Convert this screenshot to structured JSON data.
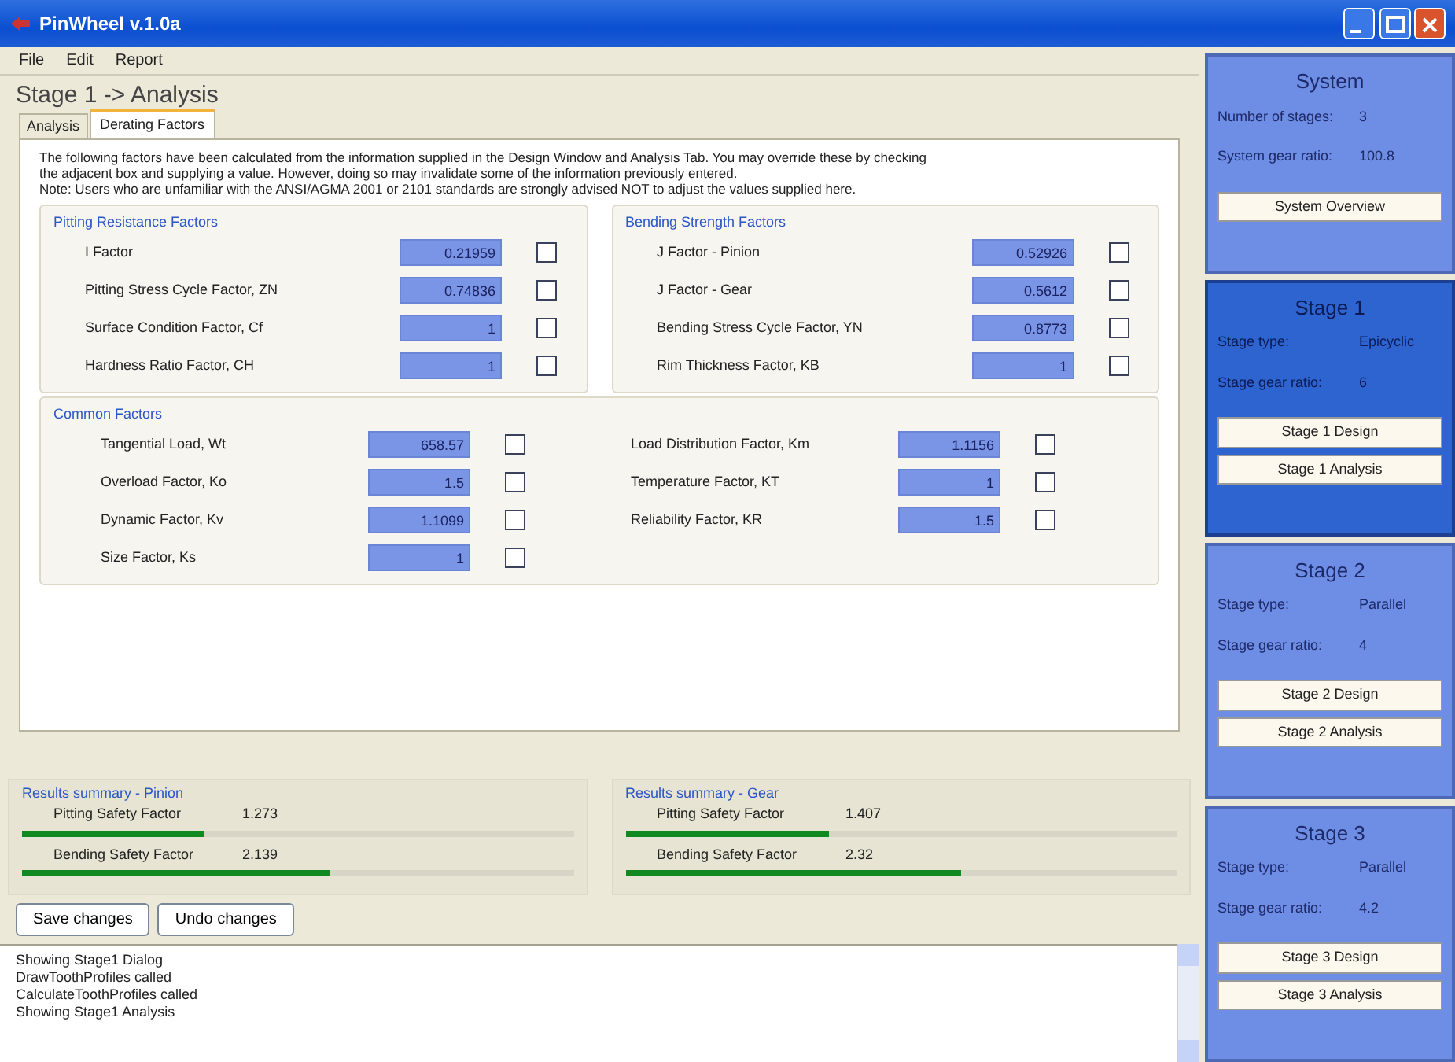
{
  "window": {
    "title": "PinWheel v.1.0a"
  },
  "menu": [
    "File",
    "Edit",
    "Report"
  ],
  "heading": "Stage 1 -> Analysis",
  "tabs": [
    {
      "label": "Analysis",
      "selected": false
    },
    {
      "label": "Derating Factors",
      "selected": true
    }
  ],
  "intro": [
    "The following factors have been calculated from the information supplied in the Design Window and Analysis Tab. You may override these by checking",
    "the adjacent box and supplying a value. However, doing so may invalidate some of the information previously entered.",
    "Note: Users who are unfamiliar with the ANSI/AGMA 2001 or 2101 standards are strongly advised NOT to adjust the values supplied here."
  ],
  "groups": [
    {
      "title": "Pitting Resistance Factors",
      "factors": [
        {
          "label": "I Factor",
          "value": "0.21959",
          "checked": false
        },
        {
          "label": "Pitting Stress Cycle Factor, ZN",
          "value": "0.74836",
          "checked": false
        },
        {
          "label": "Surface Condition Factor, Cf",
          "value": "1",
          "checked": false
        },
        {
          "label": "Hardness Ratio Factor, CH",
          "value": "1",
          "checked": false
        }
      ]
    },
    {
      "title": "Bending Strength Factors",
      "factors": [
        {
          "label": "J Factor - Pinion",
          "value": "0.52926",
          "checked": false
        },
        {
          "label": "J Factor - Gear",
          "value": "0.5612",
          "checked": false
        },
        {
          "label": "Bending Stress Cycle Factor, YN",
          "value": "0.8773",
          "checked": false
        },
        {
          "label": "Rim Thickness Factor, KB",
          "value": "1",
          "checked": false
        }
      ]
    }
  ],
  "common": {
    "title": "Common Factors",
    "columns": [
      [
        {
          "label": "Tangential Load, Wt",
          "value": "658.57",
          "checked": false
        },
        {
          "label": "Overload Factor, Ko",
          "value": "1.5",
          "checked": false
        },
        {
          "label": "Dynamic Factor, Kv",
          "value": "1.1099",
          "checked": false
        },
        {
          "label": "Size Factor, Ks",
          "value": "1",
          "checked": false
        }
      ],
      [
        {
          "label": "Load Distribution Factor, Km",
          "value": "1.1156",
          "checked": false
        },
        {
          "label": "Temperature Factor, KT",
          "value": "1",
          "checked": false
        },
        {
          "label": "Reliability Factor, KR",
          "value": "1.5",
          "checked": false
        }
      ]
    ]
  },
  "results": [
    {
      "title": "Results summary - Pinion",
      "items": [
        {
          "label": "Pitting Safety Factor",
          "reading": "1.273",
          "level": 0.33
        },
        {
          "label": "Bending Safety Factor",
          "reading": "2.139",
          "level": 0.56
        }
      ]
    },
    {
      "title": "Results summary - Gear",
      "items": [
        {
          "label": "Pitting Safety Factor",
          "reading": "1.407",
          "level": 0.37
        },
        {
          "label": "Bending Safety Factor",
          "reading": "2.32",
          "level": 0.61
        }
      ]
    }
  ],
  "buttons": [
    "Save changes",
    "Undo changes"
  ],
  "log": [
    "Showing Stage1 Dialog",
    "DrawToothProfiles called",
    "CalculateToothProfiles called",
    "Showing Stage1 Analysis"
  ],
  "system": {
    "title": "System",
    "rows": [
      [
        "Number of stages:",
        "3"
      ],
      [
        "System gear ratio:",
        "100.8"
      ]
    ],
    "buttons": [
      "System Overview"
    ]
  },
  "stages": [
    {
      "title": "Stage 1",
      "selected": true,
      "rows": [
        [
          "Stage type:",
          "Epicyclic"
        ],
        [
          "Stage gear ratio:",
          "6"
        ]
      ],
      "buttons": [
        "Stage 1 Design",
        "Stage 1 Analysis"
      ]
    },
    {
      "title": "Stage 2",
      "selected": false,
      "rows": [
        [
          "Stage type:",
          "Parallel"
        ],
        [
          "Stage gear ratio:",
          "4"
        ]
      ],
      "buttons": [
        "Stage 2 Design",
        "Stage 2 Analysis"
      ]
    },
    {
      "title": "Stage 3",
      "selected": false,
      "rows": [
        [
          "Stage type:",
          "Parallel"
        ],
        [
          "Stage gear ratio:",
          "4.2"
        ]
      ],
      "buttons": [
        "Stage 3 Design",
        "Stage 3 Analysis"
      ]
    }
  ]
}
